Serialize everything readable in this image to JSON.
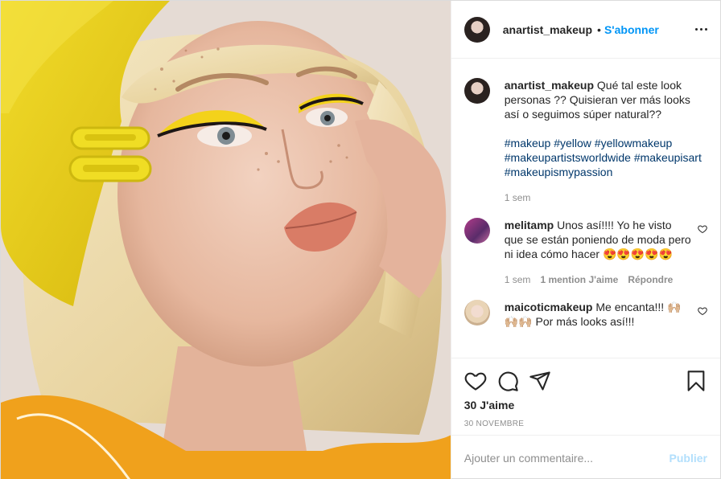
{
  "post": {
    "author": "anartist_makeup",
    "separator": "•",
    "follow_label": "S'abonner",
    "caption": {
      "username": "anartist_makeup",
      "text": "Qué tal este look personas ?? Quisieran ver más looks así o seguimos súper natural??",
      "hashtags": "#makeup #yellow #yellowmakeup #makeupartistsworldwide #makeupisart #makeupismypassion",
      "time": "1 sem"
    },
    "comments": [
      {
        "username": "melitamp",
        "text": "Unos así!!!! Yo he visto que se están poniendo de moda pero ni idea cómo hacer",
        "emoji": "😍😍😍😍😍",
        "time": "1 sem",
        "likes": "1 mention J'aime",
        "reply": "Répondre"
      },
      {
        "username": "maicoticmakeup",
        "text_before": "Me encanta!!!",
        "emoji": "🙌🏼🙌🏼🙌🏼",
        "text_after": "Por más looks así!!!"
      }
    ],
    "likes_count": "30 J'aime",
    "date": "30 NOVEMBRE",
    "comment_placeholder": "Ajouter un commentaire...",
    "publish_label": "Publier"
  },
  "icons": [
    "heart-icon",
    "comment-icon",
    "share-icon",
    "bookmark-icon",
    "more-icon"
  ],
  "colors": {
    "accent": "#0095f6",
    "hashtag": "#00376b",
    "muted": "#8e8e8e",
    "publish_disabled": "#b2dffc"
  }
}
